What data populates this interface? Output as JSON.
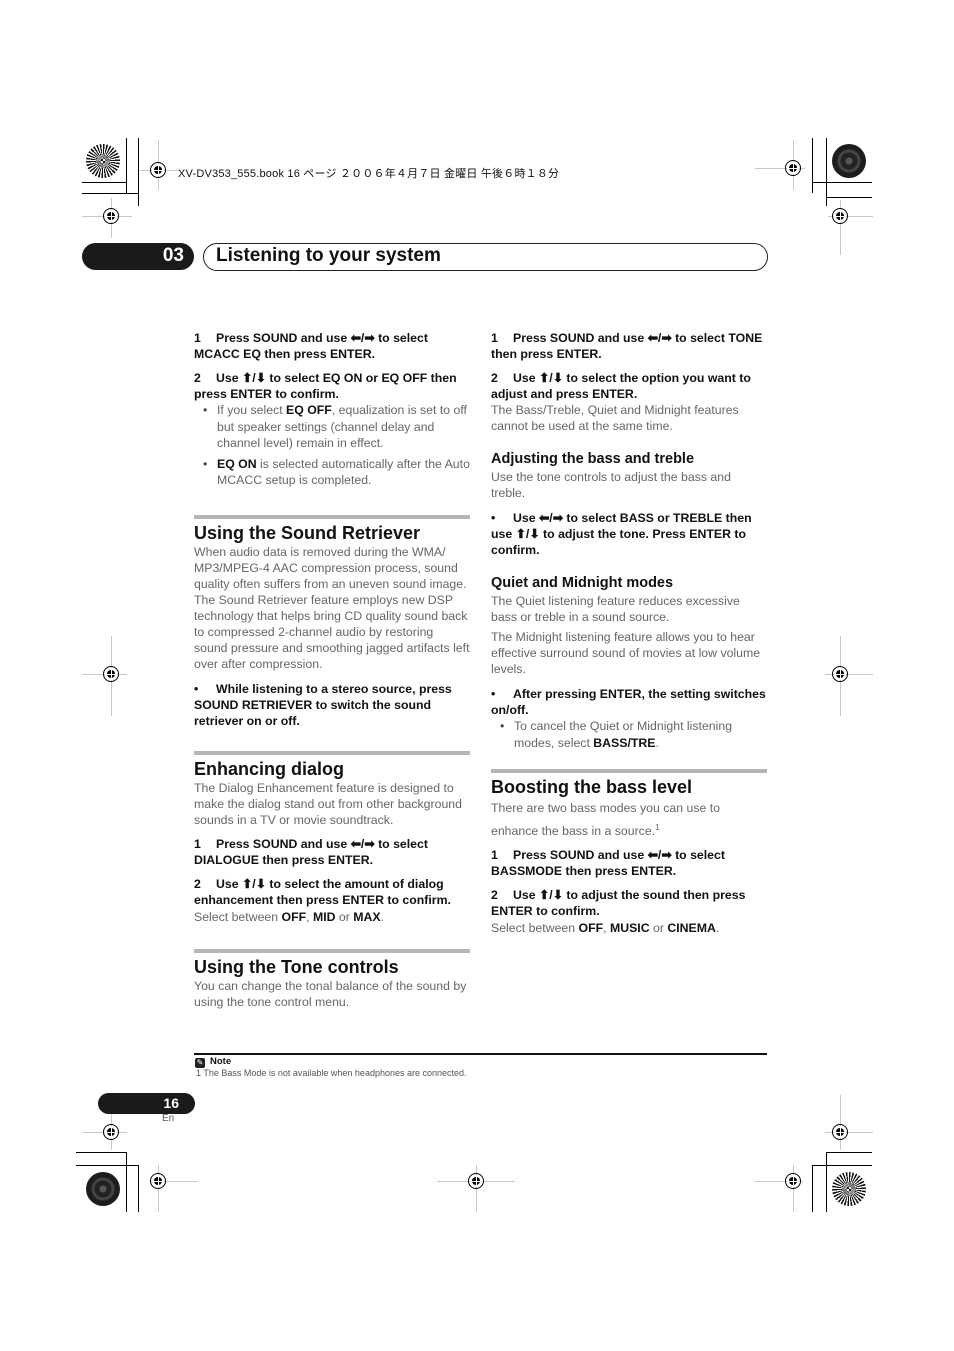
{
  "slug": "XV-DV353_555.book  16 ページ  ２００６年４月７日  金曜日  午後６時１８分",
  "chapter": {
    "number": "03",
    "title": "Listening to your system"
  },
  "left_column": {
    "intro_steps": [
      {
        "n": "1",
        "text": "Press SOUND and use ⬅/➡ to select MCACC EQ then press ENTER."
      },
      {
        "n": "2",
        "text": "Use ⬆/⬇ to select EQ ON or EQ OFF then press ENTER to confirm."
      }
    ],
    "intro_bullets": [
      {
        "bold": "EQ OFF",
        "pre": "If you select ",
        "post": ", equalization is set to off but speaker settings (channel delay and channel level) remain in effect."
      },
      {
        "bold": "EQ ON",
        "pre": "",
        "post": " is selected automatically after the Auto MCACC setup is completed."
      }
    ],
    "sound_retriever": {
      "heading": "Using the Sound Retriever",
      "body": "When audio data is removed during the WMA/ MP3/MPEG-4 AAC compression process, sound quality often suffers from an uneven sound image. The Sound Retriever feature employs new DSP technology that helps bring CD quality sound back to compressed 2-channel audio by restoring sound pressure and smoothing jagged artifacts left over after compression.",
      "instruction": "While listening to a stereo source, press SOUND RETRIEVER to switch the sound retriever on or off."
    },
    "dialog": {
      "heading": "Enhancing dialog",
      "body": "The Dialog Enhancement feature is designed to make the dialog stand out from other background sounds in a TV or movie soundtrack.",
      "steps": [
        {
          "n": "1",
          "text": "Press SOUND and use ⬅/➡ to select DIALOGUE then press ENTER."
        },
        {
          "n": "2",
          "text": "Use ⬆/⬇ to select the amount of dialog enhancement then press ENTER to confirm."
        }
      ],
      "select_prefix": "Select between ",
      "options": [
        "OFF",
        "MID",
        "MAX"
      ],
      "sep1": ", ",
      "sep2": " or ",
      "end": "."
    },
    "tone": {
      "heading": "Using the Tone controls",
      "body": "You can change the tonal balance of the sound by using the tone control menu."
    }
  },
  "right_column": {
    "tone_steps": [
      {
        "n": "1",
        "text": "Press SOUND and use ⬅/➡ to select TONE then press ENTER."
      },
      {
        "n": "2",
        "text": "Use ⬆/⬇ to select the option you want to adjust and press ENTER."
      }
    ],
    "tone_note": "The Bass/Treble, Quiet and Midnight features cannot be used at the same time.",
    "bass_treble": {
      "heading": "Adjusting the bass and treble",
      "body": "Use the tone controls to adjust the bass and treble.",
      "instruction": "Use ⬅/➡ to select BASS or TREBLE then use ⬆/⬇ to adjust the tone. Press ENTER to confirm."
    },
    "quiet_midnight": {
      "heading": "Quiet and Midnight modes",
      "body1": "The Quiet listening feature reduces excessive bass or treble in a sound source.",
      "body2": "The Midnight listening feature allows you to hear effective surround sound of movies at low volume levels.",
      "instruction": "After pressing ENTER, the setting switches on/off.",
      "bullet_pre": "To cancel the Quiet or Midnight listening modes, select ",
      "bullet_bold": "BASS/TRE",
      "bullet_post": "."
    },
    "bass_level": {
      "heading": "Boosting the bass level",
      "body": "There are two bass modes you can use to enhance the bass in a source.",
      "footnote_ref": "1",
      "steps": [
        {
          "n": "1",
          "text": "Press SOUND and use ⬅/➡ to select BASSMODE then press ENTER."
        },
        {
          "n": "2",
          "text": "Use ⬆/⬇ to adjust the sound then press ENTER to confirm."
        }
      ],
      "select_prefix": "Select between ",
      "options": [
        "OFF",
        "MUSIC",
        "CINEMA"
      ],
      "sep1": ", ",
      "sep2": " or ",
      "end": "."
    }
  },
  "footnote": {
    "label": "Note",
    "icon": "pencil-note-icon",
    "text": "1 The Bass Mode is not available when headphones are connected."
  },
  "page": {
    "number": "16",
    "lang": "En"
  }
}
